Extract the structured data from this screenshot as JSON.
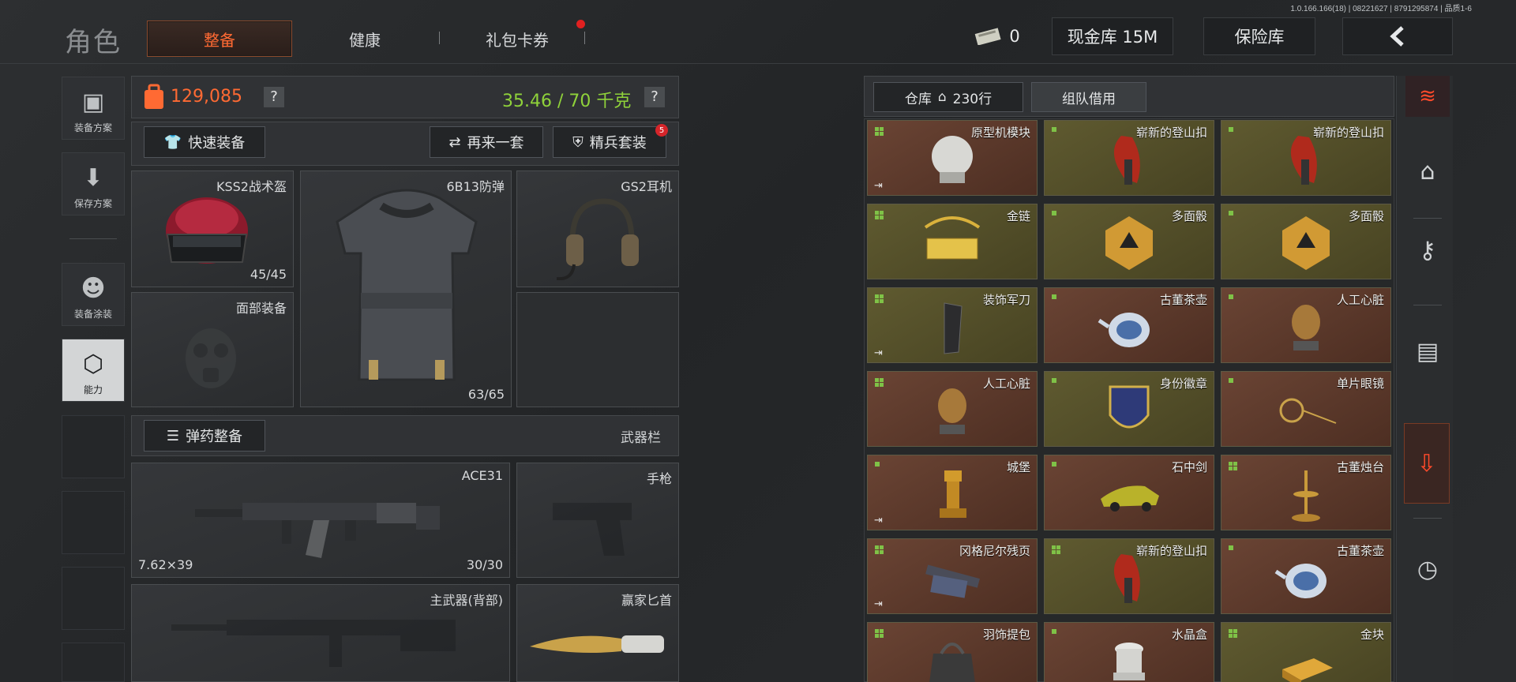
{
  "version": "1.0.166.166(18) | 08221627 | 8791295874 | 品质1-6",
  "header": {
    "title": "角色",
    "tabs": [
      "整备",
      "健康",
      "礼包卡券"
    ],
    "money_count": "0",
    "cash_vault": "现金库 15M",
    "insurance": "保险库",
    "back_icon": "chevron-left-icon"
  },
  "left_nav": [
    "装备方案",
    "保存方案",
    "装备涂装",
    "能力"
  ],
  "stats": {
    "value": "129,085",
    "help": "?",
    "weight": "35.46 / 70 千克",
    "weight_help": "?"
  },
  "actions": {
    "quick_equip": "快速装备",
    "again": "再来一套",
    "elite": "精兵套装",
    "elite_badge": "5"
  },
  "slots": {
    "helmet": {
      "name": "KSS2战术盔",
      "value": "45/45"
    },
    "armor": {
      "name": "6B13防弹",
      "value": "63/65"
    },
    "headset": {
      "name": "GS2耳机"
    },
    "face": {
      "name": "面部装备"
    }
  },
  "ammo": {
    "button": "弹药整备",
    "weapon_bar": "武器栏"
  },
  "weapons": {
    "primary": {
      "name": "ACE31",
      "caliber": "7.62×39",
      "ammo": "30/30"
    },
    "pistol": {
      "name": "手枪"
    },
    "back": {
      "name": "主武器(背部)"
    },
    "knife": {
      "name": "赢家匕首"
    }
  },
  "warehouse": {
    "tab": "仓库",
    "rows": "230行",
    "team_loan": "组队借用"
  },
  "items": [
    {
      "name": "原型机模块",
      "color": "red",
      "exit": true,
      "icon": "sphere-module-icon"
    },
    {
      "name": "崭新的登山扣",
      "color": "olive",
      "icon": "carabiner-icon"
    },
    {
      "name": "崭新的登山扣",
      "color": "olive",
      "icon": "carabiner-icon"
    },
    {
      "name": "金链",
      "color": "olive",
      "icon": "gold-chain-icon"
    },
    {
      "name": "多面骰",
      "color": "olive",
      "icon": "dice-icon"
    },
    {
      "name": "多面骰",
      "color": "olive",
      "icon": "dice-icon"
    },
    {
      "name": "装饰军刀",
      "color": "olive",
      "exit": true,
      "icon": "knife-icon"
    },
    {
      "name": "古董茶壶",
      "color": "red",
      "icon": "teapot-icon"
    },
    {
      "name": "人工心脏",
      "color": "red",
      "icon": "heart-icon"
    },
    {
      "name": "人工心脏",
      "color": "red",
      "icon": "heart-icon"
    },
    {
      "name": "身份徽章",
      "color": "olive",
      "icon": "badge-icon"
    },
    {
      "name": "单片眼镜",
      "color": "red",
      "icon": "monocle-icon"
    },
    {
      "name": "城堡",
      "color": "red",
      "exit": true,
      "icon": "rook-icon"
    },
    {
      "name": "石中剑",
      "color": "red",
      "icon": "car-icon"
    },
    {
      "name": "古董烛台",
      "color": "red",
      "icon": "candlestick-icon"
    },
    {
      "name": "冈格尼尔残页",
      "color": "red",
      "exit": true,
      "icon": "scroll-icon"
    },
    {
      "name": "崭新的登山扣",
      "color": "olive",
      "icon": "carabiner-icon"
    },
    {
      "name": "古董茶壶",
      "color": "red",
      "icon": "teapot-icon"
    },
    {
      "name": "羽饰提包",
      "color": "red",
      "icon": "bag-icon"
    },
    {
      "name": "水晶盒",
      "color": "red",
      "icon": "crystal-box-icon"
    },
    {
      "name": "金块",
      "color": "olive",
      "icon": "gold-bar-icon"
    }
  ],
  "colors": {
    "accent": "#ff6a33",
    "green": "#8fd23a",
    "item_red": "#5a3628",
    "item_olive": "#545026"
  }
}
